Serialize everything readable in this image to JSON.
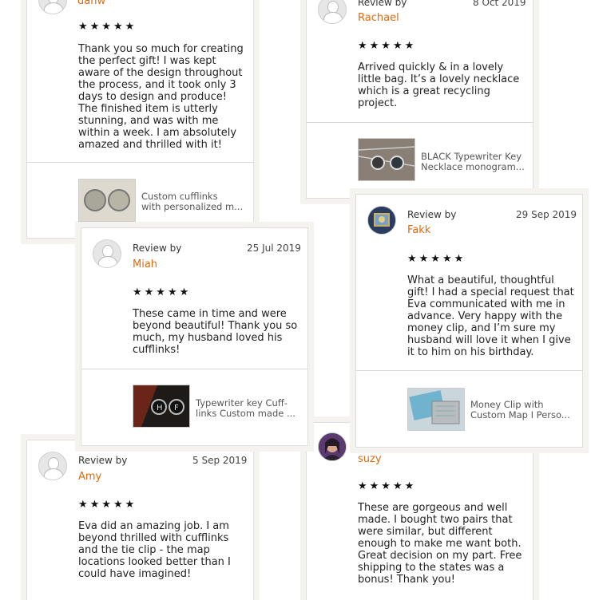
{
  "reviews": [
    {
      "reviewer": "danw",
      "stars": "★★★★★",
      "text": "Thank you so much for creating the perfect gift! I was kept aware of the design throughout the process, and it took only 3 days to design and produce! The finished item is utterly stunning, and was with me within a week. I am absolutely amazed and thrilled with it!",
      "product_line1": "Custom cufflinks",
      "product_line2": "with personalized m..."
    },
    {
      "review_by": "Review by",
      "reviewer": "Rachael",
      "date": "8 Oct 2019",
      "stars": "★★★★★",
      "text": "Arrived quickly & in a lovely little bag. It’s a lovely necklace which is a  great recycling project.",
      "product_line1": "BLACK Typewriter Key",
      "product_line2": "Necklace monogram..."
    },
    {
      "review_by": "Review by",
      "reviewer": "Miah",
      "date": "25 Jul 2019",
      "stars": "★★★★★",
      "text": "These came in time and were beyond beautiful! Thank you so much, my husband loved his cufflinks!",
      "product_line1": "Typewriter key Cuff-",
      "product_line2": "links Custom made ..."
    },
    {
      "review_by": "Review by",
      "reviewer": "Fakk",
      "date": "29 Sep 2019",
      "stars": "★★★★★",
      "text": "What a beautiful, thoughtful gift! I had a special request that Eva communicated with me in advance. Very happy with the money clip, and I’m sure my husband will love it when I give it to him on his birthday.",
      "product_line1": "Money Clip with",
      "product_line2": "Custom Map I Perso..."
    },
    {
      "review_by": "Review by",
      "reviewer": "Amy",
      "date": "5 Sep 2019",
      "stars": "★★★★★",
      "text": "Eva did an amazing job. I am beyond thrilled with cufflinks and the tie clip - the map locations looked better than I could have imagined!"
    },
    {
      "reviewer": "suzy",
      "stars": "★★★★★",
      "text": "These are gorgeous and well made.  I bought two pairs that were similar, but different enough to make me want both. Great decision on my part. Free shipping to the states was a bonus!  Thank you!"
    }
  ]
}
